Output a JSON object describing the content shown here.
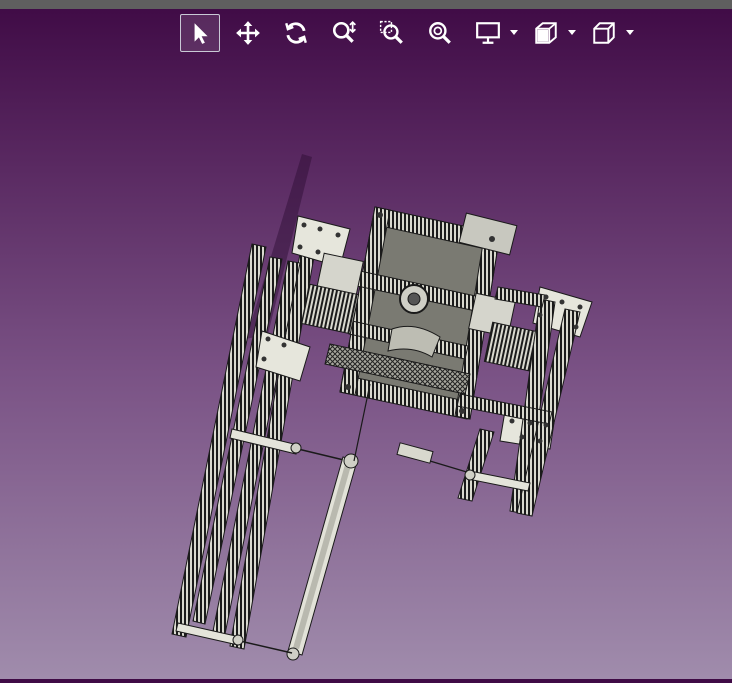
{
  "window": {
    "title": ""
  },
  "toolbar": {
    "tools": [
      {
        "id": "select",
        "icon": "cursor-arrow-icon",
        "active": true
      },
      {
        "id": "pan",
        "icon": "move-arrows-icon",
        "active": false
      },
      {
        "id": "rotate",
        "icon": "rotate-icon",
        "active": false
      },
      {
        "id": "zoom",
        "icon": "zoom-icon",
        "active": false
      },
      {
        "id": "zoom-window",
        "icon": "zoom-window-icon",
        "active": false
      },
      {
        "id": "zoom-fit",
        "icon": "zoom-fit-icon",
        "active": false
      },
      {
        "id": "display",
        "icon": "monitor-icon",
        "has_dropdown": true
      },
      {
        "id": "section",
        "icon": "section-view-icon",
        "has_dropdown": true
      },
      {
        "id": "view-orientation",
        "icon": "cube-icon",
        "has_dropdown": true
      }
    ],
    "icon_color": "#ffffff"
  },
  "viewport": {
    "background_top": "#3f0a45",
    "background_bottom": "#a08cac",
    "model": "cad-assembly-frame"
  }
}
